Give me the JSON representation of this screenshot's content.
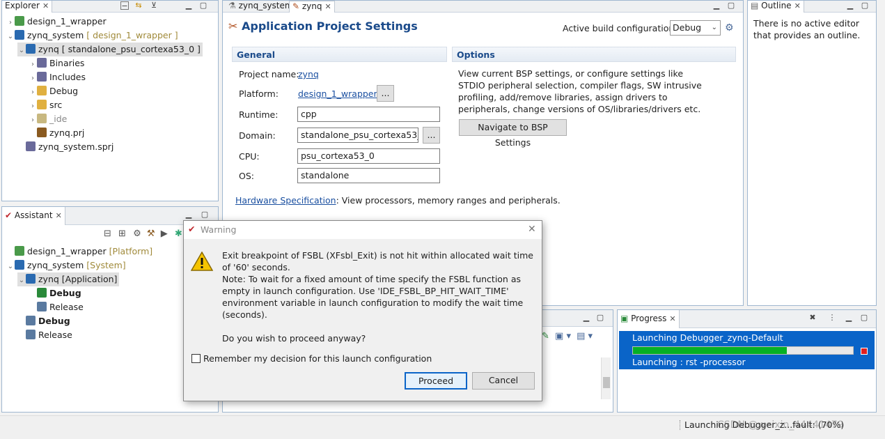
{
  "explorer": {
    "tab": "Explorer",
    "items": [
      {
        "label": "design_1_wrapper",
        "suffix": "",
        "arrow": ">"
      },
      {
        "label": "zynq_system",
        "suffix": "[ design_1_wrapper ]",
        "arrow": "v"
      },
      {
        "label": "zynq [ standalone_psu_cortexa53_0 ]",
        "suffix": "",
        "arrow": "v"
      },
      {
        "label": "Binaries",
        "suffix": "",
        "arrow": ">"
      },
      {
        "label": "Includes",
        "suffix": "",
        "arrow": ">"
      },
      {
        "label": "Debug",
        "suffix": "",
        "arrow": ">"
      },
      {
        "label": "src",
        "suffix": "",
        "arrow": ">"
      },
      {
        "label": "_ide",
        "suffix": "",
        "arrow": ">"
      },
      {
        "label": "zynq.prj",
        "suffix": "",
        "arrow": ""
      },
      {
        "label": "zynq_system.sprj",
        "suffix": "",
        "arrow": ""
      }
    ]
  },
  "assistant": {
    "tab": "Assistant",
    "items": [
      {
        "label": "design_1_wrapper",
        "suffix": "[Platform]"
      },
      {
        "label": "zynq_system",
        "suffix": "[System]"
      },
      {
        "label": "zynq [Application]",
        "suffix": ""
      },
      {
        "label": "Debug",
        "suffix": ""
      },
      {
        "label": "Release",
        "suffix": ""
      },
      {
        "label": "Debug",
        "suffix": ""
      },
      {
        "label": "Release",
        "suffix": ""
      }
    ]
  },
  "editor": {
    "tabs": [
      "zynq_system",
      "zynq"
    ],
    "title": "Application Project Settings",
    "build_label": "Active build configuration:",
    "build_value": "Debug",
    "general": {
      "heading": "General",
      "project_label": "Project name:",
      "project": "zynq",
      "platform_label": "Platform:",
      "platform": "design_1_wrapper",
      "runtime_label": "Runtime:",
      "runtime": "cpp",
      "domain_label": "Domain:",
      "domain": "standalone_psu_cortexa53_0",
      "cpu_label": "CPU:",
      "cpu": "psu_cortexa53_0",
      "os_label": "OS:",
      "os": "standalone",
      "ellipsis": "..."
    },
    "options": {
      "heading": "Options",
      "text": "View current BSP settings, or configure settings like STDIO peripheral selection, compiler flags, SW intrusive profiling, add/remove libraries, assign drivers to peripherals, change versions of OS/libraries/drivers etc.",
      "button": "Navigate to BSP Settings"
    },
    "hw_link": "Hardware Specification",
    "hw_text": ": View processors, memory ranges and peripherals."
  },
  "outline": {
    "tab": "Outline",
    "message": "There is no active editor that provides an outline."
  },
  "progress": {
    "tab": "Progress",
    "task": "Launching Debugger_zynq-Default",
    "fraction": 0.7,
    "sub": "Launching : rst -processor"
  },
  "status": {
    "text": "Launching Debugger_z...fault: (70%)",
    "watermark": "CSDN @weixin_44441479"
  },
  "dialog": {
    "title": "Warning",
    "message": "Exit breakpoint of FSBL (XFsbl_Exit) is not hit within allocated wait time of '60' seconds.\nNote: To wait for a fixed amount of time specify the FSBL function as empty in launch configuration. Use 'IDE_FSBL_BP_HIT_WAIT_TIME' environment variable in launch configuration to modify the wait time (seconds).\n\nDo you wish to proceed anyway?",
    "checkbox": "Remember my decision for this launch configuration",
    "proceed": "Proceed",
    "cancel": "Cancel"
  }
}
